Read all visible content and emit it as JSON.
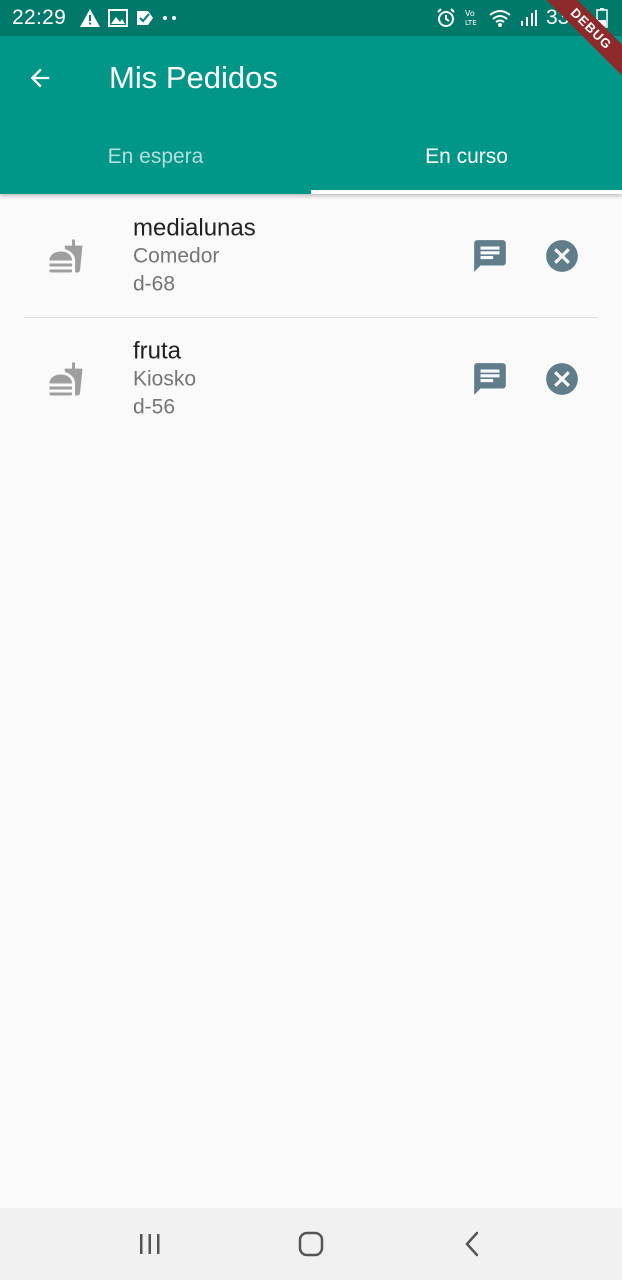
{
  "status_bar": {
    "time": "22:29",
    "battery": "33%",
    "icons_left": [
      "warning-icon",
      "image-icon",
      "check-icon",
      "dots-icon"
    ],
    "icons_right": [
      "alarm-icon",
      "volte-icon",
      "wifi-icon",
      "signal-icon",
      "battery-icon"
    ]
  },
  "debug_banner": "DEBUG",
  "header": {
    "title": "Mis Pedidos",
    "back_icon": "arrow-back-icon"
  },
  "tabs": [
    {
      "label": "En espera",
      "active": false
    },
    {
      "label": "En curso",
      "active": true
    }
  ],
  "orders": [
    {
      "name": "medialunas",
      "place": "Comedor",
      "code": "d-68"
    },
    {
      "name": "fruta",
      "place": "Kiosko",
      "code": "d-56"
    }
  ],
  "colors": {
    "primary": "#009688",
    "status_bar": "#00796b",
    "icon_action": "#607d8b",
    "icon_lead": "#9e9e9e"
  },
  "nav": [
    "recents-icon",
    "home-icon",
    "back-icon"
  ]
}
